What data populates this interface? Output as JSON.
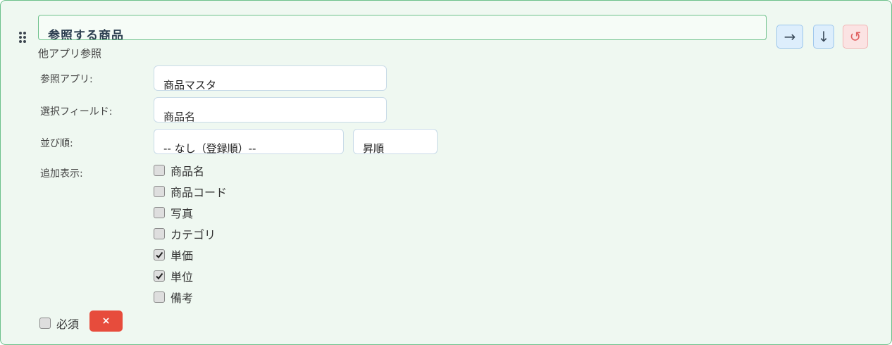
{
  "field": {
    "name_value": "参照する商品",
    "type_label": "他アプリ参照"
  },
  "controls": {
    "move_right_glyph": "→",
    "move_down_glyph": "↓",
    "reset_glyph": "↺"
  },
  "reference": {
    "app_label": "参照アプリ:",
    "app_value": "商品マスタ",
    "field_label": "選択フィールド:",
    "field_value": "商品名",
    "sort_label": "並び順:",
    "sort_value": "-- なし（登録順）--",
    "order_value": "昇順",
    "extra_label": "追加表示:"
  },
  "extra_fields": [
    {
      "label": "商品名",
      "checked": false
    },
    {
      "label": "商品コード",
      "checked": false
    },
    {
      "label": "写真",
      "checked": false
    },
    {
      "label": "カテゴリ",
      "checked": false
    },
    {
      "label": "単価",
      "checked": true
    },
    {
      "label": "単位",
      "checked": true
    },
    {
      "label": "備考",
      "checked": false
    }
  ],
  "required": {
    "label": "必須",
    "checked": false
  },
  "delete_glyph": "×"
}
